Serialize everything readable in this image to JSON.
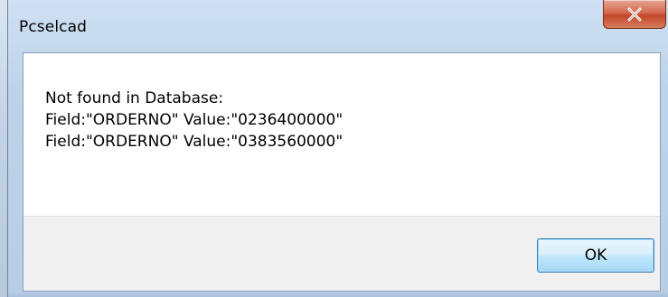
{
  "window": {
    "title": "Pcselcad",
    "close_icon": "close-icon"
  },
  "dialog": {
    "message_lines": [
      "Not found in Database:",
      "Field:\"ORDERNO\" Value:\"0236400000\"",
      "Field:\"ORDERNO\" Value:\"0383560000\""
    ],
    "ok_label": "OK"
  },
  "colors": {
    "close_button": "#c2452a",
    "ok_button_border": "#3c7fb1",
    "frame": "#bed3ea"
  }
}
